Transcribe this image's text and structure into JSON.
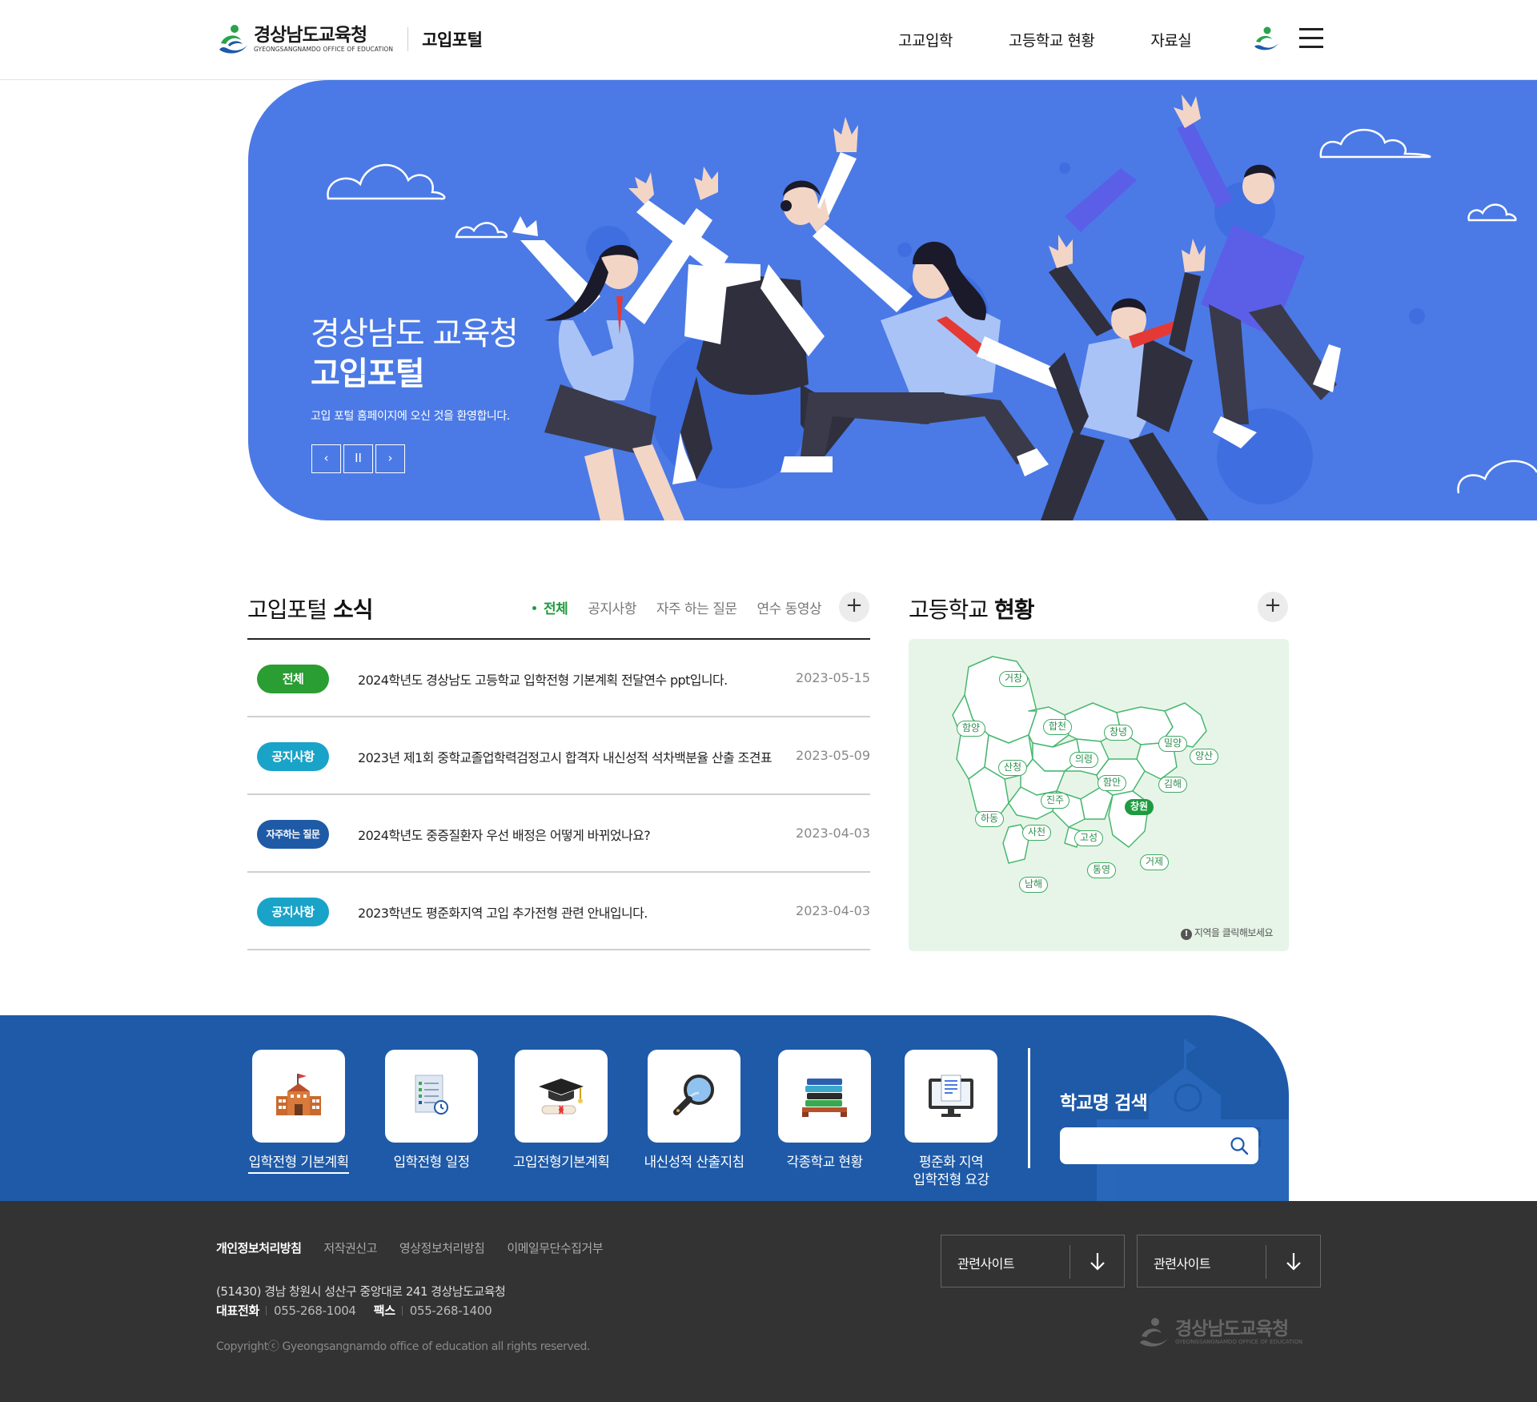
{
  "header": {
    "logo_name": "경상남도교육청",
    "logo_sub": "GYEONGSANGNAMDO OFFICE OF EDUCATION",
    "portal_name": "고입포털",
    "nav": [
      "고교입학",
      "고등학교 현황",
      "자료실"
    ]
  },
  "hero": {
    "title_line1": "경상남도 교육청",
    "title_line2": "고입포털",
    "description": "고입 포털 홈페이지에 오신 것을 환영합니다.",
    "controls": {
      "prev": "‹",
      "pause": "II",
      "next": "›"
    }
  },
  "news": {
    "title_light": "고입포털",
    "title_bold": "소식",
    "tabs": [
      "전체",
      "공지사항",
      "자주 하는 질문",
      "연수 동영상"
    ],
    "more": "+",
    "items": [
      {
        "badge": "전체",
        "badge_color": "#2a9d33",
        "title": "2024학년도 경상남도 고등학교 입학전형 기본계획 전달연수 ppt입니다.",
        "date": "2023-05-15"
      },
      {
        "badge": "공지사항",
        "badge_color": "#1aa3c8",
        "title": "2023년 제1회 중학교졸업학력검정고시 합격자 내신성적 석차백분율 산출 조견표",
        "date": "2023-05-09"
      },
      {
        "badge": "자주하는 질문",
        "badge_color": "#1f5aa6",
        "title": "2024학년도 중증질환자 우선 배정은 어떻게 바뀌었나요?",
        "date": "2023-04-03"
      },
      {
        "badge": "공지사항",
        "badge_color": "#1aa3c8",
        "title": "2023학년도 평준화지역 고입 추가전형 관련 안내입니다.",
        "date": "2023-04-03"
      }
    ]
  },
  "status": {
    "title_light": "고등학교",
    "title_bold": "현황",
    "more": "+",
    "note": "지역을 클릭해보세요",
    "note_icon": "!",
    "regions": [
      "거창",
      "함양",
      "합천",
      "창녕",
      "밀양",
      "양산",
      "산청",
      "의령",
      "함안",
      "김해",
      "진주",
      "창원",
      "하동",
      "사천",
      "고성",
      "거제",
      "통영",
      "남해"
    ],
    "active_region": "창원"
  },
  "quick": {
    "items": [
      {
        "label": "입학전형 기본계획",
        "icon": "school-building-icon"
      },
      {
        "label": "입학전형 일정",
        "icon": "schedule-document-icon"
      },
      {
        "label": "고입전형기본계획",
        "icon": "graduation-cap-icon"
      },
      {
        "label": "내신성적 산출지침",
        "icon": "magnifier-icon"
      },
      {
        "label": "각종학교 현황",
        "icon": "books-stack-icon"
      },
      {
        "label_line1": "평준화 지역",
        "label_line2": "입학전형 요강",
        "icon": "monitor-document-icon"
      }
    ],
    "search_label": "학교명 검색",
    "search_placeholder": ""
  },
  "footer": {
    "links": [
      "개인정보처리방침",
      "저작권신고",
      "영상정보처리방침",
      "이메일무단수집거부"
    ],
    "address": "(51430) 경남 창원시 성산구 중앙대로 241 경상남도교육청",
    "tel_label": "대표전화",
    "tel": "055-268-1004",
    "fax_label": "팩스",
    "fax": "055-268-1400",
    "copyright": "Copyrightⓒ Gyeongsangnamdo office of education all rights reserved.",
    "related_sites": [
      "관련사이트",
      "관련사이트"
    ],
    "logo_name": "경상남도교육청",
    "logo_sub": "GYEONGSANGNAMDO OFFICE OF EDUCATION"
  },
  "colors": {
    "hero_bg": "#4b7ae6",
    "quick_bg": "#1e5aa8",
    "accent_green": "#1f9b3f",
    "footer_bg": "#333333",
    "map_bg": "#e7f5e8"
  }
}
